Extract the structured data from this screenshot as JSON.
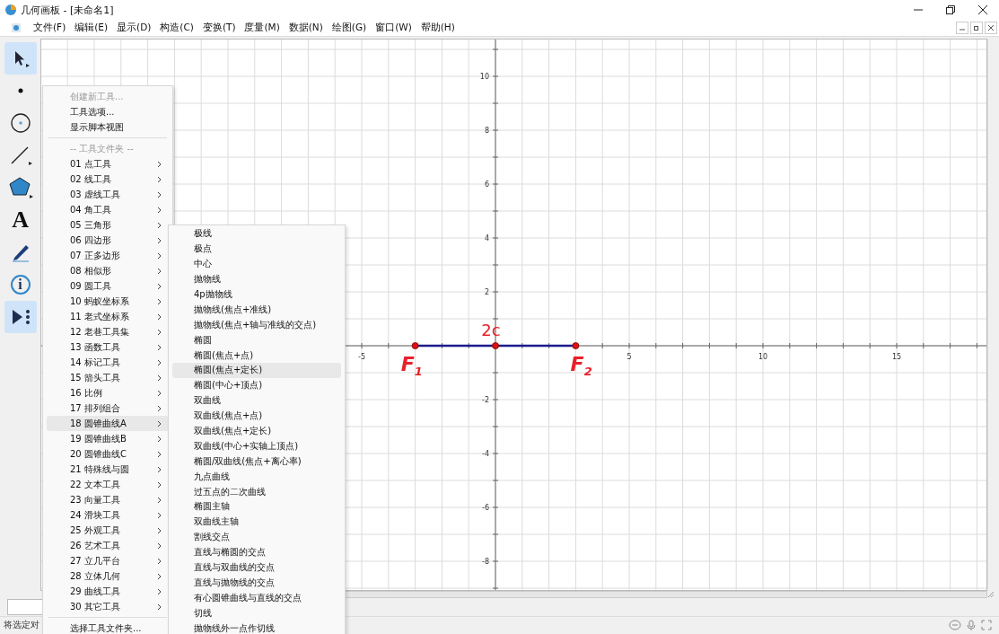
{
  "window": {
    "title": "几何画板 - [未命名1]"
  },
  "menu_bar": [
    {
      "label": "文件(F)"
    },
    {
      "label": "编辑(E)"
    },
    {
      "label": "显示(D)"
    },
    {
      "label": "构造(C)"
    },
    {
      "label": "变换(T)"
    },
    {
      "label": "度量(M)"
    },
    {
      "label": "数据(N)"
    },
    {
      "label": "绘图(G)"
    },
    {
      "label": "窗口(W)"
    },
    {
      "label": "帮助(H)"
    }
  ],
  "toolbox": [
    {
      "kind": "arrow",
      "selected": true
    },
    {
      "kind": "point",
      "selected": false
    },
    {
      "kind": "compass",
      "selected": false
    },
    {
      "kind": "line",
      "selected": false
    },
    {
      "kind": "polygon",
      "selected": false
    },
    {
      "kind": "text",
      "label": "A",
      "selected": false
    },
    {
      "kind": "marker",
      "selected": false
    },
    {
      "kind": "info",
      "label": "i",
      "selected": false
    },
    {
      "kind": "custom",
      "selected": true
    }
  ],
  "canvas": {
    "x_axis_labels": [
      "-5",
      "5",
      "10",
      "15"
    ],
    "y_axis_labels": [
      "10",
      "8",
      "6",
      "4",
      "2",
      "-2",
      "-4",
      "-6",
      "-8"
    ],
    "points": [
      {
        "label": "F$_{1}$"
      },
      {
        "label": "2c"
      },
      {
        "label": "F$_{2}$"
      }
    ]
  },
  "tool_menu": {
    "items": [
      {
        "kind": "command",
        "text": "创建新工具...",
        "disabled": true,
        "selected": false
      },
      {
        "kind": "command",
        "text": "工具选项...",
        "disabled": false,
        "selected": false
      },
      {
        "kind": "command",
        "text": "显示脚本视图",
        "disabled": false,
        "selected": false
      },
      {
        "kind": "separator"
      },
      {
        "kind": "header",
        "text": "-- 工具文件夹 --",
        "disabled": true,
        "selected": false
      },
      {
        "kind": "folder",
        "text": "01 点工具",
        "disabled": false,
        "selected": false
      },
      {
        "kind": "folder",
        "text": "02 线工具",
        "disabled": false,
        "selected": false
      },
      {
        "kind": "folder",
        "text": "03 虚线工具",
        "disabled": false,
        "selected": false
      },
      {
        "kind": "folder",
        "text": "04 角工具",
        "disabled": false,
        "selected": false
      },
      {
        "kind": "folder",
        "text": "05 三角形",
        "disabled": false,
        "selected": false
      },
      {
        "kind": "folder",
        "text": "06 四边形",
        "disabled": false,
        "selected": false
      },
      {
        "kind": "folder",
        "text": "07 正多边形",
        "disabled": false,
        "selected": false
      },
      {
        "kind": "folder",
        "text": "08 相似形",
        "disabled": false,
        "selected": false
      },
      {
        "kind": "folder",
        "text": "09 圆工具",
        "disabled": false,
        "selected": false
      },
      {
        "kind": "folder",
        "text": "10 蚂蚁坐标系",
        "disabled": false,
        "selected": false
      },
      {
        "kind": "folder",
        "text": "11 老式坐标系",
        "disabled": false,
        "selected": false
      },
      {
        "kind": "folder",
        "text": "12 老巷工具集",
        "disabled": false,
        "selected": false
      },
      {
        "kind": "folder",
        "text": "13 函数工具",
        "disabled": false,
        "selected": false
      },
      {
        "kind": "folder",
        "text": "14 标记工具",
        "disabled": false,
        "selected": false
      },
      {
        "kind": "folder",
        "text": "15 箭头工具",
        "disabled": false,
        "selected": false
      },
      {
        "kind": "folder",
        "text": "16 比例",
        "disabled": false,
        "selected": false
      },
      {
        "kind": "folder",
        "text": "17 排列组合",
        "disabled": false,
        "selected": false
      },
      {
        "kind": "folder",
        "text": "18 圆锥曲线A",
        "disabled": false,
        "selected": true
      },
      {
        "kind": "folder",
        "text": "19 圆锥曲线B",
        "disabled": false,
        "selected": false
      },
      {
        "kind": "folder",
        "text": "20 圆锥曲线C",
        "disabled": false,
        "selected": false
      },
      {
        "kind": "folder",
        "text": "21 特殊线与圆",
        "disabled": false,
        "selected": false
      },
      {
        "kind": "folder",
        "text": "22 文本工具",
        "disabled": false,
        "selected": false
      },
      {
        "kind": "folder",
        "text": "23 向量工具",
        "disabled": false,
        "selected": false
      },
      {
        "kind": "folder",
        "text": "24 滑块工具",
        "disabled": false,
        "selected": false
      },
      {
        "kind": "folder",
        "text": "25 外观工具",
        "disabled": false,
        "selected": false
      },
      {
        "kind": "folder",
        "text": "26 艺术工具",
        "disabled": false,
        "selected": false
      },
      {
        "kind": "folder",
        "text": "27 立几平台",
        "disabled": false,
        "selected": false
      },
      {
        "kind": "folder",
        "text": "28 立体几何",
        "disabled": false,
        "selected": false
      },
      {
        "kind": "folder",
        "text": "29 曲线工具",
        "disabled": false,
        "selected": false
      },
      {
        "kind": "folder",
        "text": "30 其它工具",
        "disabled": false,
        "selected": false
      },
      {
        "kind": "separator"
      },
      {
        "kind": "command",
        "text": "选择工具文件夹...",
        "disabled": false,
        "selected": false
      }
    ]
  },
  "submenu": {
    "items": [
      {
        "text": "极线",
        "selected": false
      },
      {
        "text": "极点",
        "selected": false
      },
      {
        "text": "中心",
        "selected": false
      },
      {
        "text": "抛物线",
        "selected": false
      },
      {
        "text": "4p抛物线",
        "selected": false
      },
      {
        "text": "抛物线(焦点+准线)",
        "selected": false
      },
      {
        "text": "抛物线(焦点+轴与准线的交点)",
        "selected": false
      },
      {
        "text": "椭圆",
        "selected": false
      },
      {
        "text": "椭圆(焦点+点)",
        "selected": false
      },
      {
        "text": "椭圆(焦点+定长)",
        "selected": true
      },
      {
        "text": "椭圆(中心+顶点)",
        "selected": false
      },
      {
        "text": "双曲线",
        "selected": false
      },
      {
        "text": "双曲线(焦点+点)",
        "selected": false
      },
      {
        "text": "双曲线(焦点+定长)",
        "selected": false
      },
      {
        "text": "双曲线(中心+实轴上顶点)",
        "selected": false
      },
      {
        "text": "椭圆/双曲线(焦点+离心率)",
        "selected": false
      },
      {
        "text": "九点曲线",
        "selected": false
      },
      {
        "text": "过五点的二次曲线",
        "selected": false
      },
      {
        "text": "椭圆主轴",
        "selected": false
      },
      {
        "text": "双曲线主轴",
        "selected": false
      },
      {
        "text": "割线交点",
        "selected": false
      },
      {
        "text": "直线与椭圆的交点",
        "selected": false
      },
      {
        "text": "直线与双曲线的交点",
        "selected": false
      },
      {
        "text": "直线与抛物线的交点",
        "selected": false
      },
      {
        "text": "有心圆锥曲线与直线的交点",
        "selected": false
      },
      {
        "text": "切线",
        "selected": false
      },
      {
        "text": "抛物线外一点作切线",
        "selected": false
      }
    ]
  },
  "status_bar": {
    "text": "将选定对"
  }
}
